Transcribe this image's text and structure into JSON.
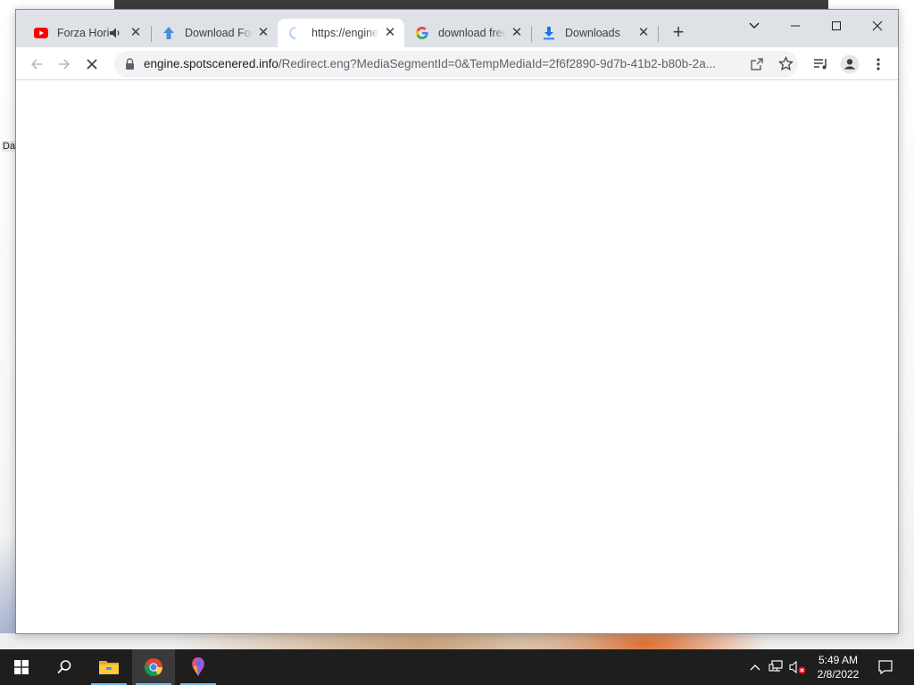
{
  "browser": {
    "tabs": [
      {
        "title": "Forza Hori",
        "favicon": "youtube-icon",
        "audio": true,
        "active": false
      },
      {
        "title": "Download For",
        "favicon": "upload-arrow-icon",
        "audio": false,
        "active": false
      },
      {
        "title": "https://engine",
        "favicon": "loading-spinner-icon",
        "audio": false,
        "active": true
      },
      {
        "title": "download free",
        "favicon": "google-icon",
        "audio": false,
        "active": false
      },
      {
        "title": "Downloads",
        "favicon": "download-icon",
        "audio": false,
        "active": false
      }
    ],
    "new_tab": "+",
    "address": {
      "domain": "engine.spotscenered.info",
      "path": "/Redirect.eng?MediaSegmentId=0&TempMediaId=2f6f2890-9d7b-41b2-b80b-2a..."
    }
  },
  "taskbar": {
    "time": "5:49 AM",
    "date": "2/8/2022",
    "apps": [
      "start-icon",
      "search-icon",
      "file-explorer-icon",
      "chrome-icon",
      "paint-icon"
    ]
  },
  "desktop": {
    "icon_label": "Da"
  },
  "colors": {
    "tabstrip": "#dee1e6",
    "omnibox": "#f1f3f4",
    "taskbar": "#1e1e1e",
    "youtube_red": "#ff0000",
    "link_blue": "#1a73e8"
  }
}
